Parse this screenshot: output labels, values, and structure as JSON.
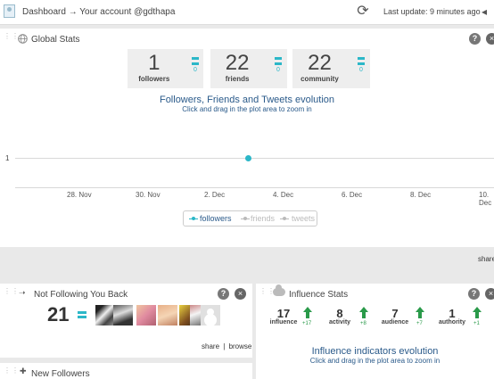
{
  "header": {
    "breadcrumb": "Dashboard → Your account @gdthapa",
    "last_update": "Last update: 9 minutes ago"
  },
  "global_stats": {
    "title": "Global Stats",
    "stats": [
      {
        "value": "1",
        "label": "followers",
        "delta": "0"
      },
      {
        "value": "22",
        "label": "friends",
        "delta": "0"
      },
      {
        "value": "22",
        "label": "community",
        "delta": "0"
      }
    ],
    "chart_title": "Followers, Friends and Tweets evolution",
    "chart_subtitle": "Click and drag in the plot area to zoom in",
    "share": "share"
  },
  "chart_data": {
    "type": "line",
    "title": "Followers, Friends and Tweets evolution",
    "subtitle": "Click and drag in the plot area to zoom in",
    "y_ticks": [
      "1"
    ],
    "x_ticks": [
      "28. Nov",
      "30. Nov",
      "2. Dec",
      "4. Dec",
      "6. Dec",
      "8. Dec",
      "10. Dec"
    ],
    "series": [
      {
        "name": "followers",
        "points": [
          {
            "x": "3. Dec",
            "y": 1
          }
        ],
        "color": "#2bb7c8",
        "active": true
      },
      {
        "name": "friends",
        "points": [],
        "color": "#bbbbbb",
        "active": false
      },
      {
        "name": "tweets",
        "points": [],
        "color": "#bbbbbb",
        "active": false
      }
    ],
    "legend": "bottom-center"
  },
  "not_following_back": {
    "title": "Not Following You Back",
    "count": "21",
    "share": "share",
    "browse": "browse"
  },
  "new_followers": {
    "title": "New Followers"
  },
  "influence_stats": {
    "title": "Influence Stats",
    "stats": [
      {
        "value": "17",
        "label": "influence",
        "delta": "+17"
      },
      {
        "value": "8",
        "label": "activity",
        "delta": "+8"
      },
      {
        "value": "7",
        "label": "audience",
        "delta": "+7"
      },
      {
        "value": "1",
        "label": "authority",
        "delta": "+1"
      }
    ],
    "chart_title": "Influence indicators evolution",
    "chart_subtitle": "Click and drag in the plot area to zoom in"
  },
  "icons": {
    "help": "?",
    "close": "×",
    "refresh": "⟳",
    "arrow": "◂",
    "globe": "globe-icon"
  },
  "colors": {
    "accent": "#2bb7c8",
    "title_blue": "#2a5a8a",
    "up_green": "#2a9a4a"
  }
}
